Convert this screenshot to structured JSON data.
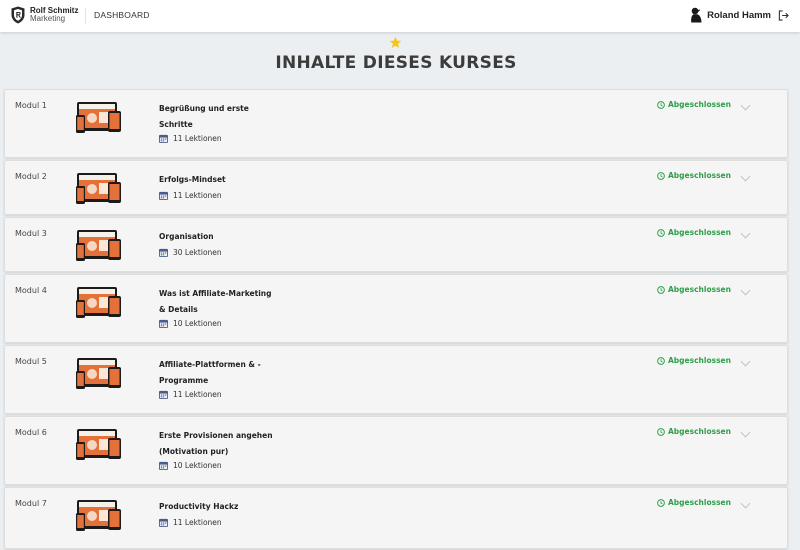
{
  "header": {
    "brand_line1": "Rolf Schmitz",
    "brand_line2": "Marketing",
    "nav_dashboard": "DASHBOARD",
    "user_name": "Roland Hamm"
  },
  "page": {
    "title": "INHALTE DIESES KURSES"
  },
  "colors": {
    "status_green": "#2e9e4a",
    "star": "#f4c51c",
    "calendar": "#4a5b8f"
  },
  "modules": [
    {
      "number": "Modul 1",
      "title": "Begrüßung und erste Schritte",
      "lessons": "11 Lektionen",
      "status": "Abgeschlossen"
    },
    {
      "number": "Modul 2",
      "title": "Erfolgs-Mindset",
      "lessons": "11 Lektionen",
      "status": "Abgeschlossen"
    },
    {
      "number": "Modul 3",
      "title": "Organisation",
      "lessons": "30 Lektionen",
      "status": "Abgeschlossen"
    },
    {
      "number": "Modul 4",
      "title": "Was ist Affiliate-Marketing & Details",
      "lessons": "10 Lektionen",
      "status": "Abgeschlossen"
    },
    {
      "number": "Modul 5",
      "title": "Affiliate-Plattformen & -Programme",
      "lessons": "11 Lektionen",
      "status": "Abgeschlossen"
    },
    {
      "number": "Modul 6",
      "title": "Erste Provisionen angehen (Motivation pur)",
      "lessons": "10 Lektionen",
      "status": "Abgeschlossen"
    },
    {
      "number": "Modul 7",
      "title": "Productivity Hackz",
      "lessons": "11 Lektionen",
      "status": "Abgeschlossen"
    }
  ]
}
